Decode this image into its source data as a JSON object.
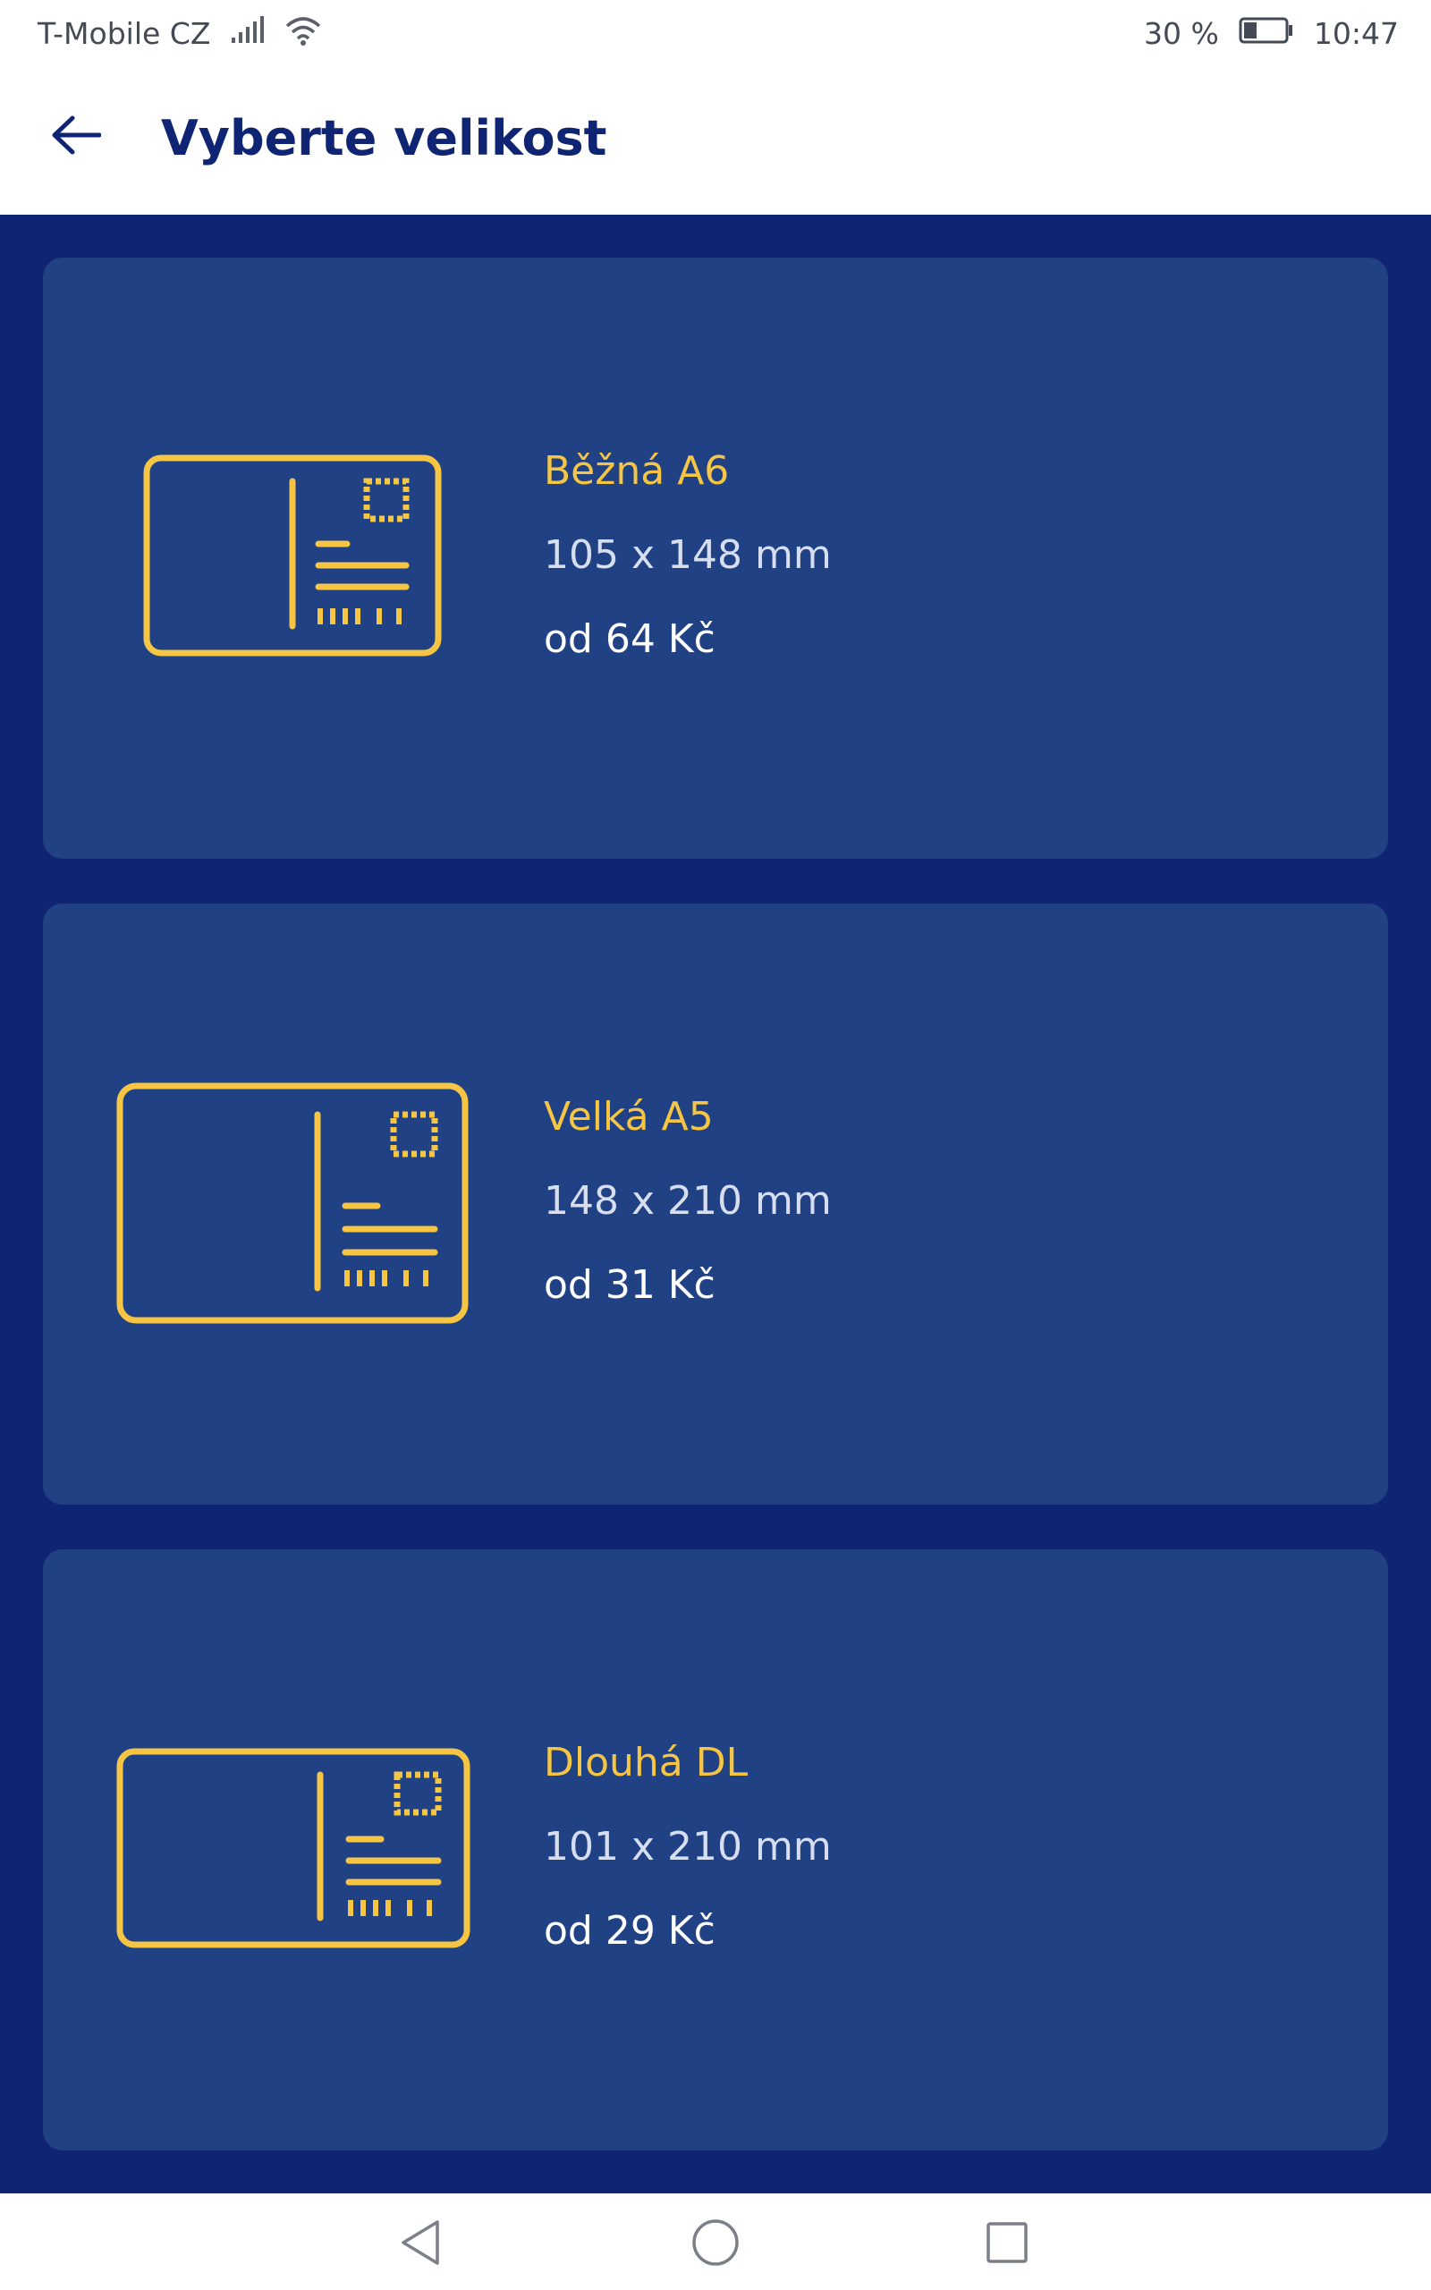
{
  "status": {
    "carrier": "T-Mobile CZ",
    "battery": "30 %",
    "time": "10:47",
    "icons": [
      "signal-icon",
      "wifi-icon",
      "battery-icon"
    ]
  },
  "header": {
    "title": "Vyberte velikost",
    "back_icon": "arrow-left-icon"
  },
  "cards": [
    {
      "name": "Běžná A6",
      "dimensions": "105 x 148 mm",
      "price": "od 64 Kč",
      "icon": "postcard-icon"
    },
    {
      "name": "Velká A5",
      "dimensions": "148 x 210 mm",
      "price": "od 31 Kč",
      "icon": "postcard-icon"
    },
    {
      "name": "Dlouhá DL",
      "dimensions": "101 x 210 mm",
      "price": "od 29 Kč",
      "icon": "postcard-icon"
    }
  ],
  "navigation": {
    "icons": [
      "back-triangle-icon",
      "home-circle-icon",
      "recents-square-icon"
    ]
  },
  "colors": {
    "background": "#0f2573",
    "card": "#214185",
    "accent": "#f6c544",
    "title": "#0f2573"
  }
}
